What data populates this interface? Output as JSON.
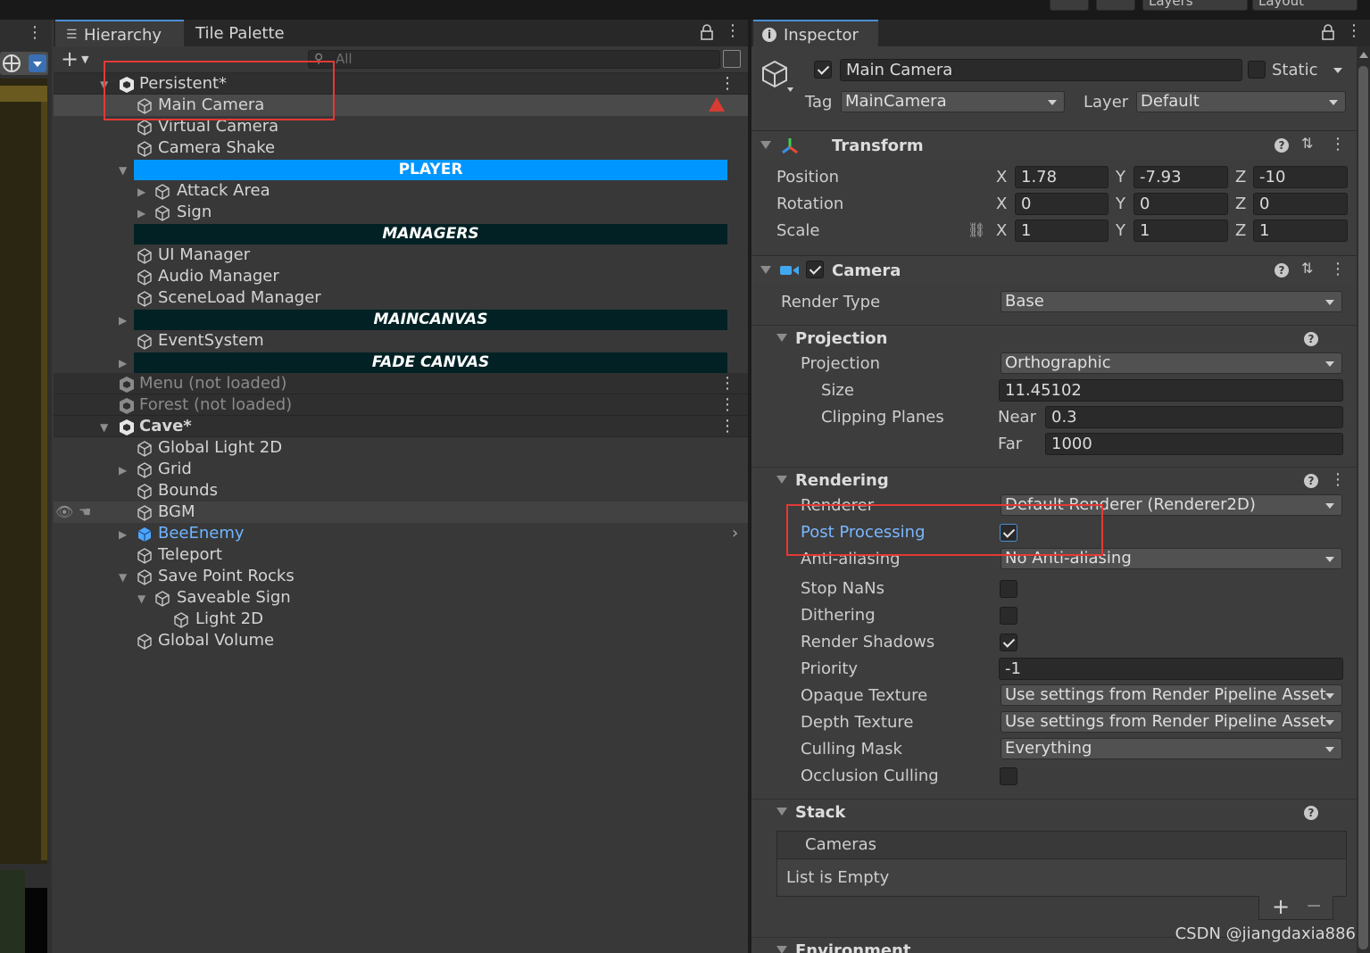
{
  "toolbar": {
    "layers_label": "Layers",
    "layout_label": "Layout"
  },
  "hierarchy": {
    "tabs": [
      {
        "label": "Hierarchy"
      },
      {
        "label": "Tile Palette"
      }
    ],
    "search_placeholder": "All",
    "rows": [
      {
        "label": "Persistent*"
      },
      {
        "label": "Main Camera"
      },
      {
        "label": "Virtual Camera"
      },
      {
        "label": "Camera Shake"
      },
      {
        "label": "PLAYER"
      },
      {
        "label": "Attack Area"
      },
      {
        "label": "Sign"
      },
      {
        "label": "MANAGERS"
      },
      {
        "label": "UI Manager"
      },
      {
        "label": "Audio Manager"
      },
      {
        "label": "SceneLoad Manager"
      },
      {
        "label": "MAINCANVAS"
      },
      {
        "label": "EventSystem"
      },
      {
        "label": "FADE CANVAS"
      },
      {
        "label": "Menu (not loaded)"
      },
      {
        "label": "Forest (not loaded)"
      },
      {
        "label": "Cave*"
      },
      {
        "label": "Global Light 2D"
      },
      {
        "label": "Grid"
      },
      {
        "label": "Bounds"
      },
      {
        "label": "BGM"
      },
      {
        "label": "BeeEnemy"
      },
      {
        "label": "Teleport"
      },
      {
        "label": "Save Point Rocks"
      },
      {
        "label": "Saveable Sign"
      },
      {
        "label": "Light 2D"
      },
      {
        "label": "Global Volume"
      }
    ]
  },
  "inspector": {
    "tab_label": "Inspector",
    "object_name": "Main Camera",
    "static_label": "Static",
    "tag_label": "Tag",
    "tag_value": "MainCamera",
    "layer_label": "Layer",
    "layer_value": "Default",
    "transform": {
      "title": "Transform",
      "position_label": "Position",
      "position": [
        "1.78",
        "-7.93",
        "-10"
      ],
      "rotation_label": "Rotation",
      "rotation": [
        "0",
        "0",
        "0"
      ],
      "scale_label": "Scale",
      "scale": [
        "1",
        "1",
        "1"
      ],
      "axes": [
        "X",
        "Y",
        "Z"
      ]
    },
    "camera": {
      "title": "Camera",
      "render_type_label": "Render Type",
      "render_type": "Base",
      "projection_section": "Projection",
      "projection_label": "Projection",
      "projection_value": "Orthographic",
      "size_label": "Size",
      "size_value": "11.45102",
      "clipping_label": "Clipping Planes",
      "near_label": "Near",
      "near_value": "0.3",
      "far_label": "Far",
      "far_value": "1000",
      "rendering_section": "Rendering",
      "renderer_label": "Renderer",
      "renderer_value": "Default Renderer (Renderer2D)",
      "post_processing_label": "Post Processing",
      "antialiasing_label": "Anti-aliasing",
      "antialiasing_value": "No Anti-aliasing",
      "stop_nans_label": "Stop NaNs",
      "dithering_label": "Dithering",
      "render_shadows_label": "Render Shadows",
      "priority_label": "Priority",
      "priority_value": "-1",
      "opaque_texture_label": "Opaque Texture",
      "opaque_texture_value": "Use settings from Render Pipeline Asset",
      "depth_texture_label": "Depth Texture",
      "depth_texture_value": "Use settings from Render Pipeline Asset",
      "culling_mask_label": "Culling Mask",
      "culling_mask_value": "Everything",
      "occlusion_label": "Occlusion Culling",
      "stack_section": "Stack",
      "cameras_label": "Cameras",
      "list_empty": "List is Empty",
      "add_symbol": "+",
      "remove_symbol": "−",
      "environment_section": "Environment"
    }
  },
  "watermark": "CSDN @jiangdaxia886",
  "colors": {
    "player_banner": "#0096ff",
    "dark_banner": "#012124",
    "highlight_box": "#e53935",
    "prefab_blue": "#4ea6ff"
  }
}
